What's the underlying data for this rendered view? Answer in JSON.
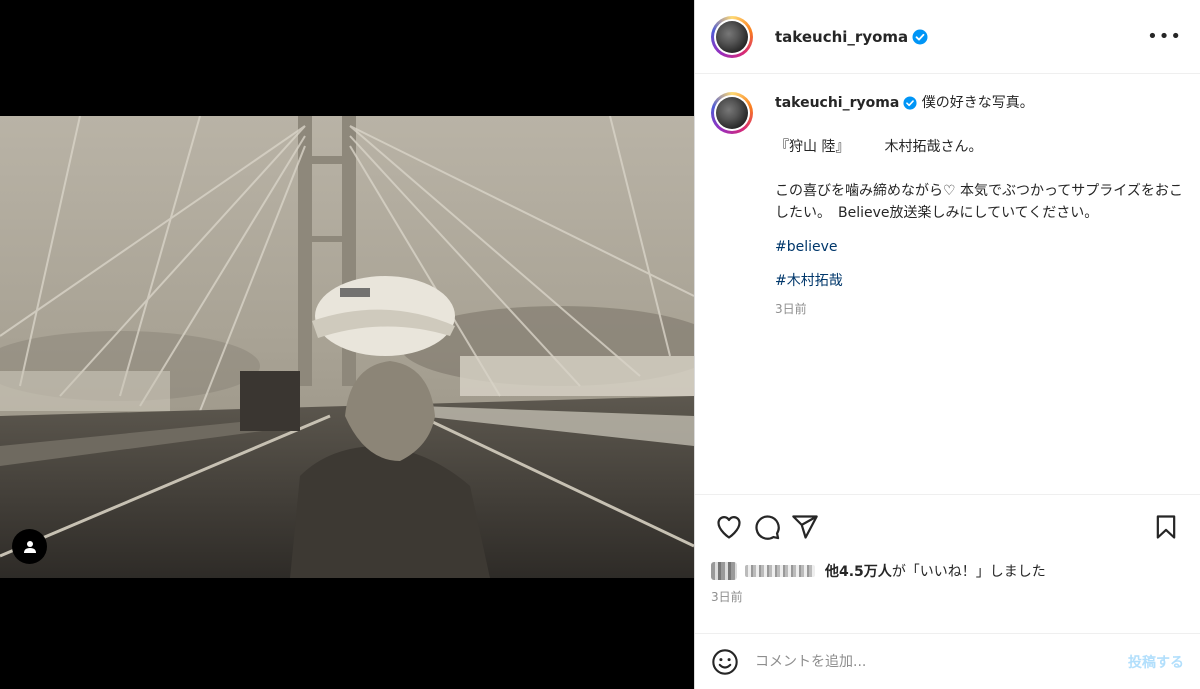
{
  "post": {
    "username": "takeuchi_ryoma",
    "verified": true,
    "more_label": "•••"
  },
  "caption": {
    "username": "takeuchi_ryoma",
    "text": " 僕の好きな写真。\n\n『狩山 陸』　　　木村拓哉さん。\n\nこの喜びを噛み締めながら♡ 本気でぶつかってサプライズをおこしたい。　Believe放送楽しみにしていてください。",
    "hashtags": [
      "#believe",
      "#木村拓哉"
    ],
    "time": "3日前"
  },
  "likes": {
    "text_bold": "他4.5万人",
    "text_rest": "が「いいね！」しました"
  },
  "post_time": "3日前",
  "comment": {
    "placeholder": "コメントを追加...",
    "post_label": "投稿する"
  },
  "icons": [
    "user-tag-icon",
    "verified-icon",
    "more-icon",
    "heart-icon",
    "comment-icon",
    "share-icon",
    "bookmark-icon",
    "emoji-icon"
  ],
  "colors": {
    "link": "#00376b",
    "verified": "#0095f6",
    "post_button": "#b2dffc"
  }
}
